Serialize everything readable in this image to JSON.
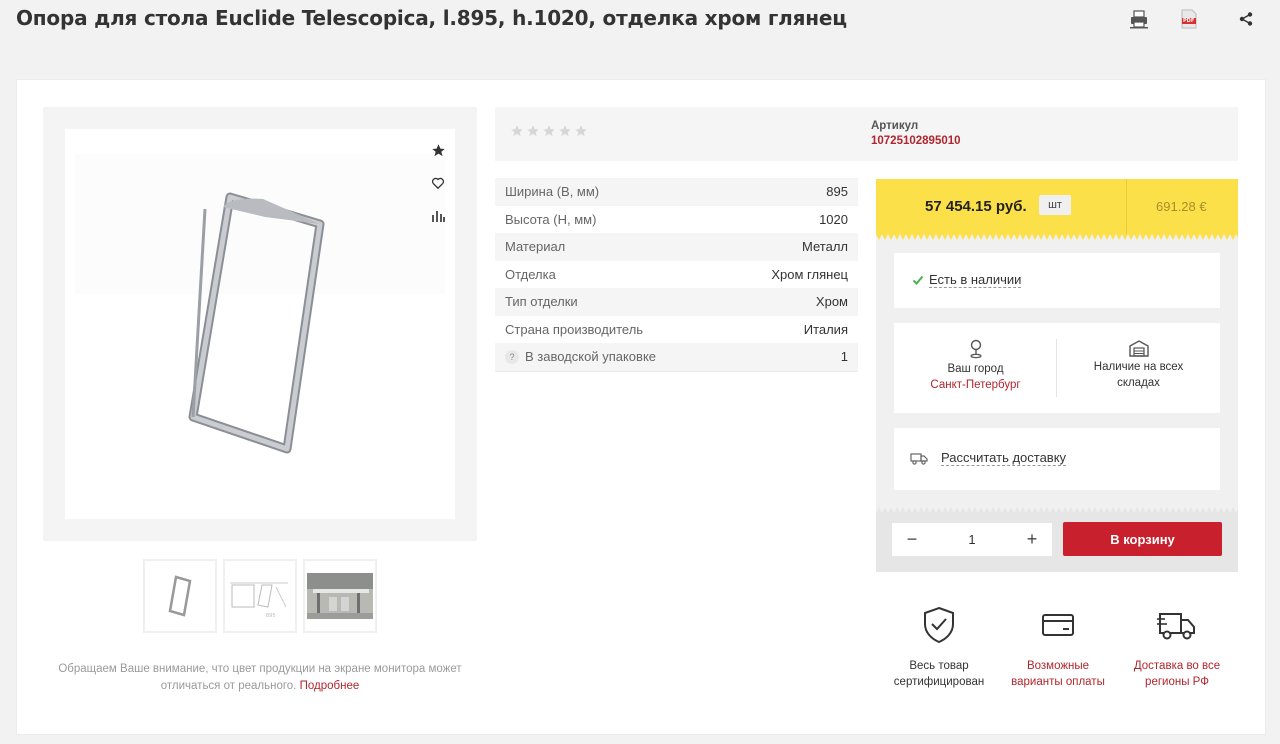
{
  "header": {
    "title": "Опора для стола Euclide Telescopica, l.895, h.1020, отделка хром глянец",
    "icons": [
      "print-icon",
      "pdf-icon",
      "share-icon"
    ],
    "pdf_label": "PDF"
  },
  "gallery": {
    "side_icons": [
      "star-icon",
      "heart-icon",
      "compare-icon"
    ],
    "thumbnails": [
      "frame-leg-thumb",
      "drawing-thumb",
      "table-photo-thumb"
    ],
    "disclaimer": "Обращаем Ваше внимание, что цвет продукции на экране монитора может отличаться от реального.",
    "more_link": "Подробнее"
  },
  "rating": {
    "stars_filled": 0,
    "stars_total": 5
  },
  "article": {
    "label": "Артикул",
    "value": "10725102895010"
  },
  "properties": [
    {
      "name": "Ширина (В, мм)",
      "value": "895"
    },
    {
      "name": "Высота (Н, мм)",
      "value": "1020"
    },
    {
      "name": "Материал",
      "value": "Металл"
    },
    {
      "name": "Отделка",
      "value": "Хром глянец"
    },
    {
      "name": "Тип отделки",
      "value": "Хром"
    },
    {
      "name": "Страна производитель",
      "value": "Италия"
    },
    {
      "name": "В заводской упаковке",
      "value": "1",
      "hint_icon": "?"
    }
  ],
  "buy": {
    "price": "57 454.15 руб.",
    "unit": "шт",
    "price_eur": "691.28 €",
    "availability": "Есть в наличии",
    "city_label": "Ваш город",
    "city": "Санкт-Петербург",
    "warehouses": "Наличие на всех складах",
    "delivery": "Рассчитать доставку",
    "quantity": "1",
    "minus": "−",
    "plus": "+",
    "add_to_cart": "В корзину"
  },
  "features": [
    {
      "icon": "shield-check-icon",
      "text": "Весь товар сертифицирован"
    },
    {
      "icon": "card-icon",
      "text": "Возможные варианты оплаты"
    },
    {
      "icon": "truck-icon",
      "text": "Доставка во все регионы РФ"
    }
  ],
  "colors": {
    "accent_red": "#c9202e",
    "link_red": "#b0262e",
    "price_yellow": "#fce04a",
    "check_green": "#4caf50"
  }
}
